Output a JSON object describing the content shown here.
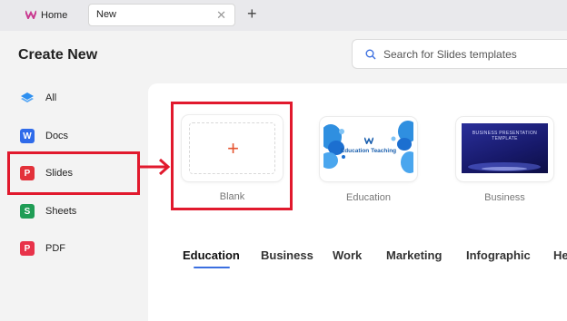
{
  "tabs": [
    {
      "label": "Home"
    },
    {
      "label": "New"
    }
  ],
  "header": {
    "title": "Create New",
    "search_placeholder": "Search for Slides templates"
  },
  "sidebar": {
    "items": [
      {
        "label": "All",
        "icon": "layers-icon"
      },
      {
        "label": "Docs",
        "icon": "docs-icon",
        "glyph": "W"
      },
      {
        "label": "Slides",
        "icon": "slides-icon",
        "glyph": "P"
      },
      {
        "label": "Sheets",
        "icon": "sheets-icon",
        "glyph": "S"
      },
      {
        "label": "PDF",
        "icon": "pdf-icon",
        "glyph": "P"
      }
    ],
    "selected": "Slides"
  },
  "templates": [
    {
      "label": "Blank"
    },
    {
      "label": "Education",
      "thumb_title": "Education Teaching"
    },
    {
      "label": "Business",
      "thumb_title": "BUSINESS PRESENTATION TEMPLATE"
    }
  ],
  "categories": [
    "Education",
    "Business",
    "Work",
    "Marketing",
    "Infographic",
    "He"
  ],
  "active_category": "Education",
  "colors": {
    "accent": "#3b6fe0",
    "annotation": "#e1192d",
    "plus": "#e5532f"
  }
}
